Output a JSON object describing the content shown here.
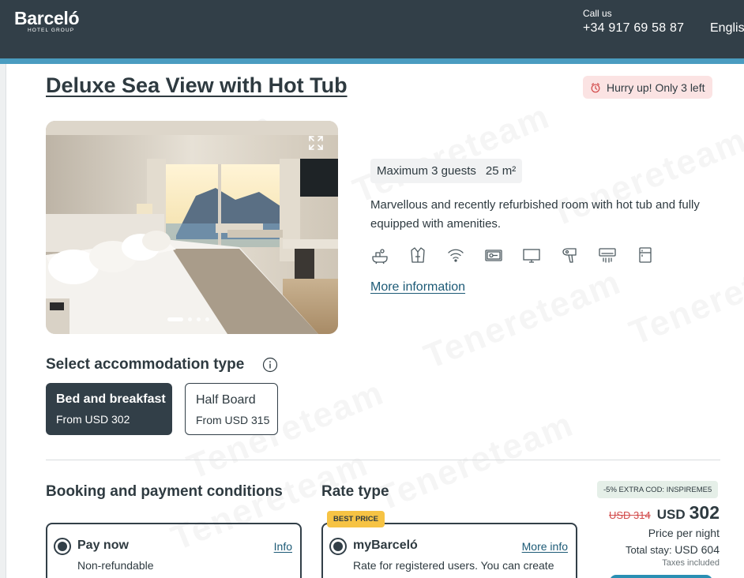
{
  "header": {
    "brand": "Barceló",
    "brand_sub": "HOTEL GROUP",
    "call_us_label": "Call us",
    "phone": "+34 917 69 58 87",
    "language": "English"
  },
  "room": {
    "title": "Deluxe Sea View with Hot Tub",
    "urgency": "Hurry up! Only 3 left",
    "capacity": "Maximum 3 guests",
    "size": "25 m²",
    "description": "Marvellous and recently refurbished room with hot tub and fully equipped with amenities.",
    "more_info": "More information",
    "amenity_icons": [
      "hot-tub-icon",
      "bathrobe-icon",
      "wifi-icon",
      "safe-icon",
      "tv-icon",
      "hairdryer-icon",
      "air-conditioning-icon",
      "minibar-icon"
    ],
    "gallery": {
      "slides_count": 4,
      "active_slide": 1,
      "expand_icon": "expand-icon"
    }
  },
  "accommodation": {
    "title": "Select accommodation type",
    "options": [
      {
        "name": "Bed and breakfast",
        "price": "From USD 302",
        "selected": true
      },
      {
        "name": "Half Board",
        "price": "From USD 315",
        "selected": false
      }
    ]
  },
  "booking": {
    "title": "Booking and payment conditions",
    "option_name": "Pay now",
    "option_link": "Info",
    "option_sub": "Non-refundable"
  },
  "rate": {
    "title": "Rate type",
    "badge": "BEST PRICE",
    "option_name": "myBarceló",
    "option_link": "More info",
    "option_sub": "Rate for registered users. You can create"
  },
  "price": {
    "promo": "-5% EXTRA COD: INSPIREME5",
    "old_price": "USD 314",
    "currency": "USD",
    "amount": "302",
    "per_night": "Price per night",
    "total_label": "Total stay:",
    "total_value": "USD 604",
    "taxes": "Taxes included"
  },
  "watermark": "Tenereteam",
  "colors": {
    "header_bg": "#323f48",
    "accent": "#4a9cc0",
    "link": "#1c5a76",
    "urgency_bg": "#fbe3e3",
    "badge_bg": "#f6c344",
    "old_price": "#d24b4b"
  }
}
